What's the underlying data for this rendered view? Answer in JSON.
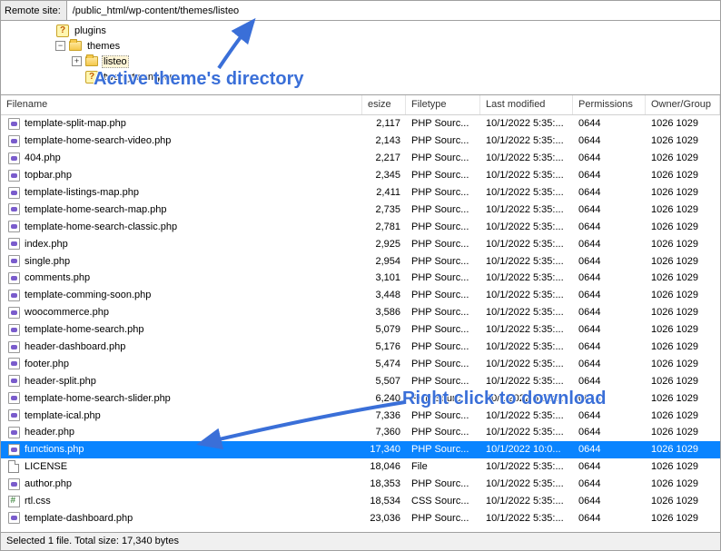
{
  "remote": {
    "label": "Remote site:",
    "path": "/public_html/wp-content/themes/listeo"
  },
  "tree": {
    "plugins": "plugins",
    "themes": "themes",
    "listeo": "listeo",
    "twentytwentytwo": "twentytwentytwo"
  },
  "headers": {
    "name": "Filename",
    "size": "esize",
    "type": "Filetype",
    "mod": "Last modified",
    "perm": "Permissions",
    "own": "Owner/Group"
  },
  "files": [
    {
      "name": "template-split-map.php",
      "size": "2,117",
      "type": "PHP Sourc...",
      "mod": "10/1/2022 5:35:...",
      "perm": "0644",
      "own": "1026 1029",
      "icon": "php"
    },
    {
      "name": "template-home-search-video.php",
      "size": "2,143",
      "type": "PHP Sourc...",
      "mod": "10/1/2022 5:35:...",
      "perm": "0644",
      "own": "1026 1029",
      "icon": "php"
    },
    {
      "name": "404.php",
      "size": "2,217",
      "type": "PHP Sourc...",
      "mod": "10/1/2022 5:35:...",
      "perm": "0644",
      "own": "1026 1029",
      "icon": "php"
    },
    {
      "name": "topbar.php",
      "size": "2,345",
      "type": "PHP Sourc...",
      "mod": "10/1/2022 5:35:...",
      "perm": "0644",
      "own": "1026 1029",
      "icon": "php"
    },
    {
      "name": "template-listings-map.php",
      "size": "2,411",
      "type": "PHP Sourc...",
      "mod": "10/1/2022 5:35:...",
      "perm": "0644",
      "own": "1026 1029",
      "icon": "php"
    },
    {
      "name": "template-home-search-map.php",
      "size": "2,735",
      "type": "PHP Sourc...",
      "mod": "10/1/2022 5:35:...",
      "perm": "0644",
      "own": "1026 1029",
      "icon": "php"
    },
    {
      "name": "template-home-search-classic.php",
      "size": "2,781",
      "type": "PHP Sourc...",
      "mod": "10/1/2022 5:35:...",
      "perm": "0644",
      "own": "1026 1029",
      "icon": "php"
    },
    {
      "name": "index.php",
      "size": "2,925",
      "type": "PHP Sourc...",
      "mod": "10/1/2022 5:35:...",
      "perm": "0644",
      "own": "1026 1029",
      "icon": "php"
    },
    {
      "name": "single.php",
      "size": "2,954",
      "type": "PHP Sourc...",
      "mod": "10/1/2022 5:35:...",
      "perm": "0644",
      "own": "1026 1029",
      "icon": "php"
    },
    {
      "name": "comments.php",
      "size": "3,101",
      "type": "PHP Sourc...",
      "mod": "10/1/2022 5:35:...",
      "perm": "0644",
      "own": "1026 1029",
      "icon": "php"
    },
    {
      "name": "template-comming-soon.php",
      "size": "3,448",
      "type": "PHP Sourc...",
      "mod": "10/1/2022 5:35:...",
      "perm": "0644",
      "own": "1026 1029",
      "icon": "php"
    },
    {
      "name": "woocommerce.php",
      "size": "3,586",
      "type": "PHP Sourc...",
      "mod": "10/1/2022 5:35:...",
      "perm": "0644",
      "own": "1026 1029",
      "icon": "php"
    },
    {
      "name": "template-home-search.php",
      "size": "5,079",
      "type": "PHP Sourc...",
      "mod": "10/1/2022 5:35:...",
      "perm": "0644",
      "own": "1026 1029",
      "icon": "php"
    },
    {
      "name": "header-dashboard.php",
      "size": "5,176",
      "type": "PHP Sourc...",
      "mod": "10/1/2022 5:35:...",
      "perm": "0644",
      "own": "1026 1029",
      "icon": "php"
    },
    {
      "name": "footer.php",
      "size": "5,474",
      "type": "PHP Sourc...",
      "mod": "10/1/2022 5:35:...",
      "perm": "0644",
      "own": "1026 1029",
      "icon": "php"
    },
    {
      "name": "header-split.php",
      "size": "5,507",
      "type": "PHP Sourc...",
      "mod": "10/1/2022 5:35:...",
      "perm": "0644",
      "own": "1026 1029",
      "icon": "php"
    },
    {
      "name": "template-home-search-slider.php",
      "size": "6,240",
      "type": "PHP Sourc...",
      "mod": "10/1/2022 5:35:...",
      "perm": "0644",
      "own": "1026 1029",
      "icon": "php"
    },
    {
      "name": "template-ical.php",
      "size": "7,336",
      "type": "PHP Sourc...",
      "mod": "10/1/2022 5:35:...",
      "perm": "0644",
      "own": "1026 1029",
      "icon": "php"
    },
    {
      "name": "header.php",
      "size": "7,360",
      "type": "PHP Sourc...",
      "mod": "10/1/2022 5:35:...",
      "perm": "0644",
      "own": "1026 1029",
      "icon": "php"
    },
    {
      "name": "functions.php",
      "size": "17,340",
      "type": "PHP Sourc...",
      "mod": "10/1/2022 10:0...",
      "perm": "0644",
      "own": "1026 1029",
      "icon": "php",
      "selected": true
    },
    {
      "name": "LICENSE",
      "size": "18,046",
      "type": "File",
      "mod": "10/1/2022 5:35:...",
      "perm": "0644",
      "own": "1026 1029",
      "icon": "doc"
    },
    {
      "name": "author.php",
      "size": "18,353",
      "type": "PHP Sourc...",
      "mod": "10/1/2022 5:35:...",
      "perm": "0644",
      "own": "1026 1029",
      "icon": "php"
    },
    {
      "name": "rtl.css",
      "size": "18,534",
      "type": "CSS Sourc...",
      "mod": "10/1/2022 5:35:...",
      "perm": "0644",
      "own": "1026 1029",
      "icon": "css"
    },
    {
      "name": "template-dashboard.php",
      "size": "23,036",
      "type": "PHP Sourc...",
      "mod": "10/1/2022 5:35:...",
      "perm": "0644",
      "own": "1026 1029",
      "icon": "php"
    }
  ],
  "status": "Selected 1 file. Total size: 17,340 bytes",
  "annotations": {
    "top": "Active theme's directory",
    "right": "Right click to download"
  }
}
